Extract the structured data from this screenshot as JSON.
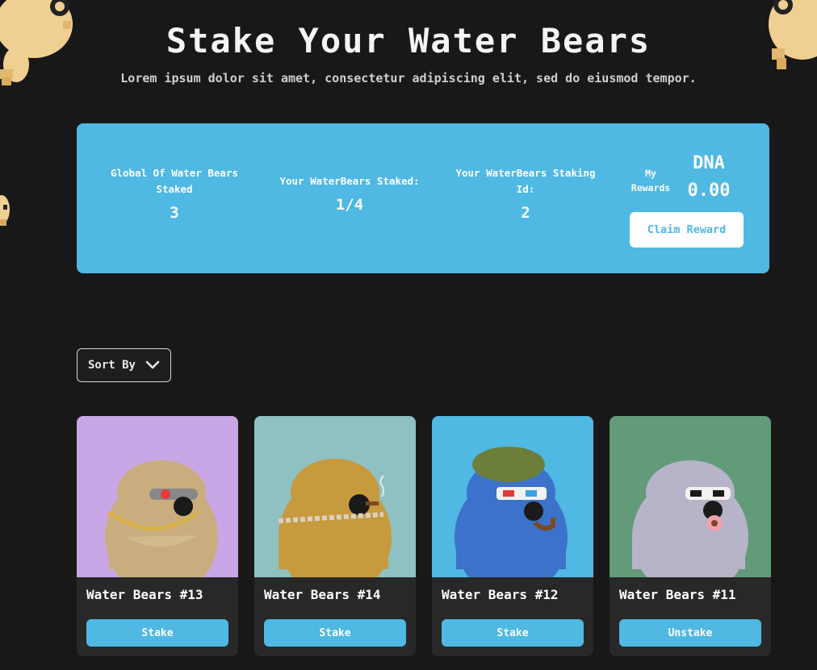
{
  "hero": {
    "title": "Stake Your Water Bears",
    "subtitle": "Lorem ipsum dolor sit amet, consectetur adipiscing elit, sed do eiusmod tempor."
  },
  "stats": {
    "global_label": "Global Of Water Bears Staked",
    "global_value": "3",
    "staked_label": "Your WaterBears Staked:",
    "staked_value": "1/4",
    "staking_id_label": "Your WaterBears Staking Id:",
    "staking_id_value": "2",
    "rewards_label": "My Rewards",
    "dna_label": "DNA",
    "dna_value": "0.00",
    "claim_label": "Claim Reward"
  },
  "sort": {
    "label": "Sort By",
    "icon": "chevron-down-icon"
  },
  "cards": [
    {
      "name": "Water Bears #13",
      "action": "Stake",
      "bg": "#c9a7e6",
      "body": "#c9ad7e",
      "accessory": "chain"
    },
    {
      "name": "Water Bears #14",
      "action": "Stake",
      "bg": "#8fc1c3",
      "body": "#c79a3e",
      "accessory": "pipe-smoke"
    },
    {
      "name": "Water Bears #12",
      "action": "Stake",
      "bg": "#4fb8e3",
      "body": "#3c72c9",
      "accessory": "beret-pipe"
    },
    {
      "name": "Water Bears #11",
      "action": "Unstake",
      "bg": "#629a7a",
      "body": "#b7b4c9",
      "accessory": "donut"
    }
  ],
  "colors": {
    "accent": "#4fb8e3",
    "background": "#181818",
    "card": "#282828"
  }
}
